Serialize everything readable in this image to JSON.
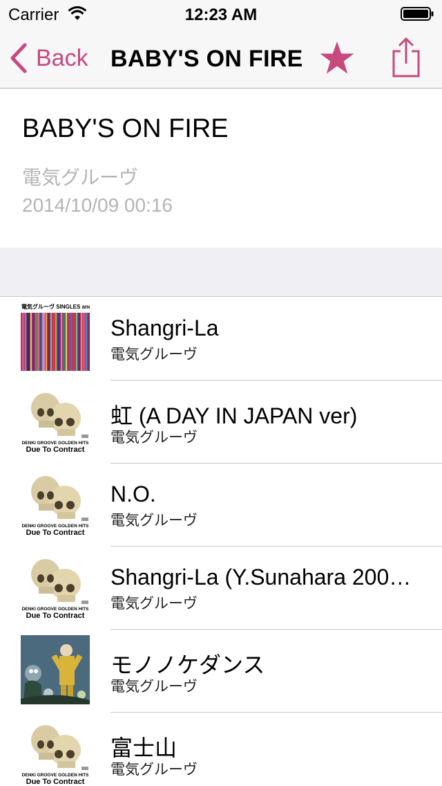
{
  "status_bar": {
    "carrier": "Carrier",
    "time": "12:23 AM"
  },
  "nav": {
    "back_label": "Back",
    "title": "BABY'S ON FIRE"
  },
  "header": {
    "title": "BABY'S ON FIRE",
    "artist": "電気グルーヴ",
    "date": "2014/10/09 00:16"
  },
  "tracks": [
    {
      "title": "Shangri-La",
      "artist": "電気グルーヴ",
      "art": "singles-and-strikes",
      "art_text": "電気グルーヴ SINGLES and STRIKES"
    },
    {
      "title": "虹 (A DAY IN JAPAN ver)",
      "artist": "電気グルーヴ",
      "art": "skulls",
      "art_text": "DENKI GROOVE GOLDEN HITS Due To Contract"
    },
    {
      "title": "N.O.",
      "artist": "電気グルーヴ",
      "art": "skulls",
      "art_text": "DENKI GROOVE GOLDEN HITS Due To Contract"
    },
    {
      "title": "Shangri-La (Y.Sunahara 200…",
      "artist": "電気グルーヴ",
      "art": "skulls",
      "art_text": "DENKI GROOVE GOLDEN HITS Due To Contract"
    },
    {
      "title": "モノノケダンス",
      "artist": "電気グルーヴ",
      "art": "illustration"
    },
    {
      "title": "富士山",
      "artist": "電気グルーヴ",
      "art": "skulls",
      "art_text": "DENKI GROOVE GOLDEN HITS Due To Contract"
    }
  ],
  "colors": {
    "accent": "#c7497e",
    "secondary_text": "#b4b4b4"
  },
  "icons": [
    "wifi-icon",
    "battery-icon",
    "back-chevron-icon",
    "star-icon",
    "share-icon"
  ]
}
